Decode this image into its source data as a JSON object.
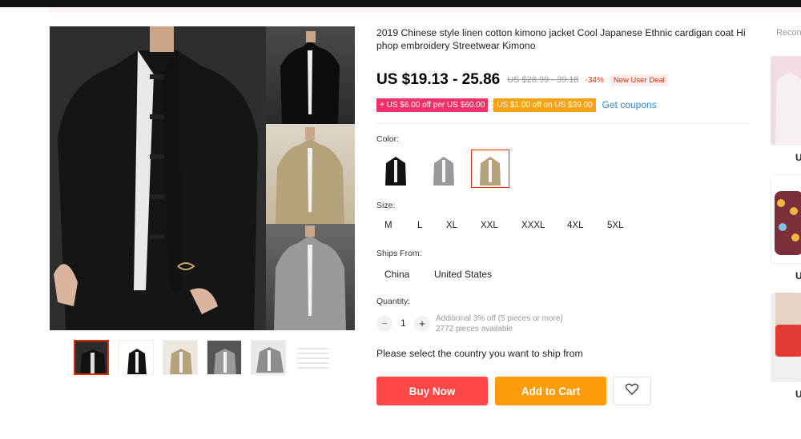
{
  "product": {
    "title": "2019 Chinese style linen cotton kimono jacket Cool Japanese Ethnic cardigan coat Hi phop embroidery Streetwear Kimono",
    "price": "US $19.13 - 25.86",
    "old_price": "US $28.99 - 39.18",
    "discount": "-34%",
    "new_user_deal": "New User Deal"
  },
  "coupons": {
    "coupon1": "+ US $6.00 off per US $60.00",
    "coupon2": "US $1.00 off on US $39.00",
    "get_coupons": "Get coupons"
  },
  "color": {
    "label": "Color:",
    "options": [
      "black",
      "grey",
      "khaki"
    ],
    "selected": "khaki"
  },
  "size": {
    "label": "Size:",
    "options": [
      "M",
      "L",
      "XL",
      "XXL",
      "XXXL",
      "4XL",
      "5XL"
    ]
  },
  "ships_from": {
    "label": "Ships From:",
    "options": [
      "China",
      "United States"
    ]
  },
  "quantity": {
    "label": "Quantity:",
    "value": "1",
    "minus": "−",
    "plus": "+",
    "note1": "Additional 3% off (5 pieces or more)",
    "note2": "2772 pieces available"
  },
  "ship_message": "Please select the country you want to ship from",
  "buttons": {
    "buy_now": "Buy Now",
    "add_to_cart": "Add to Cart",
    "wishlist_icon": "heart-icon"
  },
  "recommended": {
    "title": "Recon",
    "price_prefix": "U"
  },
  "colors": {
    "buy_now": "#ff4747",
    "add_to_cart": "#ff9c0b",
    "price_red": "#e62e04",
    "coupon_red": "#f0316a",
    "coupon_orange": "#f7a314",
    "link_blue": "#2f8ad0"
  }
}
